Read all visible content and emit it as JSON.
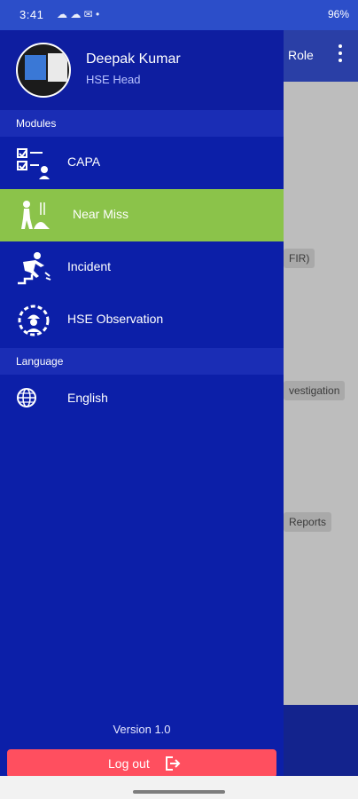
{
  "status_bar": {
    "time": "3:41",
    "left_icons": "☁ ☁ ✉ •",
    "right_text": "96%"
  },
  "background": {
    "header_text": "Role",
    "chips": [
      "FIR)",
      "vestigation",
      "Reports"
    ]
  },
  "profile": {
    "name": "Deepak Kumar",
    "role": "HSE Head"
  },
  "sections": {
    "modules": "Modules",
    "language": "Language"
  },
  "menu": {
    "capa": "CAPA",
    "near_miss": "Near Miss",
    "incident": "Incident",
    "hse_observation": "HSE Observation",
    "english": "English"
  },
  "footer": {
    "version": "Version 1.0",
    "logout": "Log out"
  },
  "colors": {
    "drawer": "#0c1fa8",
    "active": "#8bc34a",
    "logout": "#ff4f5f",
    "statusbar": "#2c4ec9"
  }
}
